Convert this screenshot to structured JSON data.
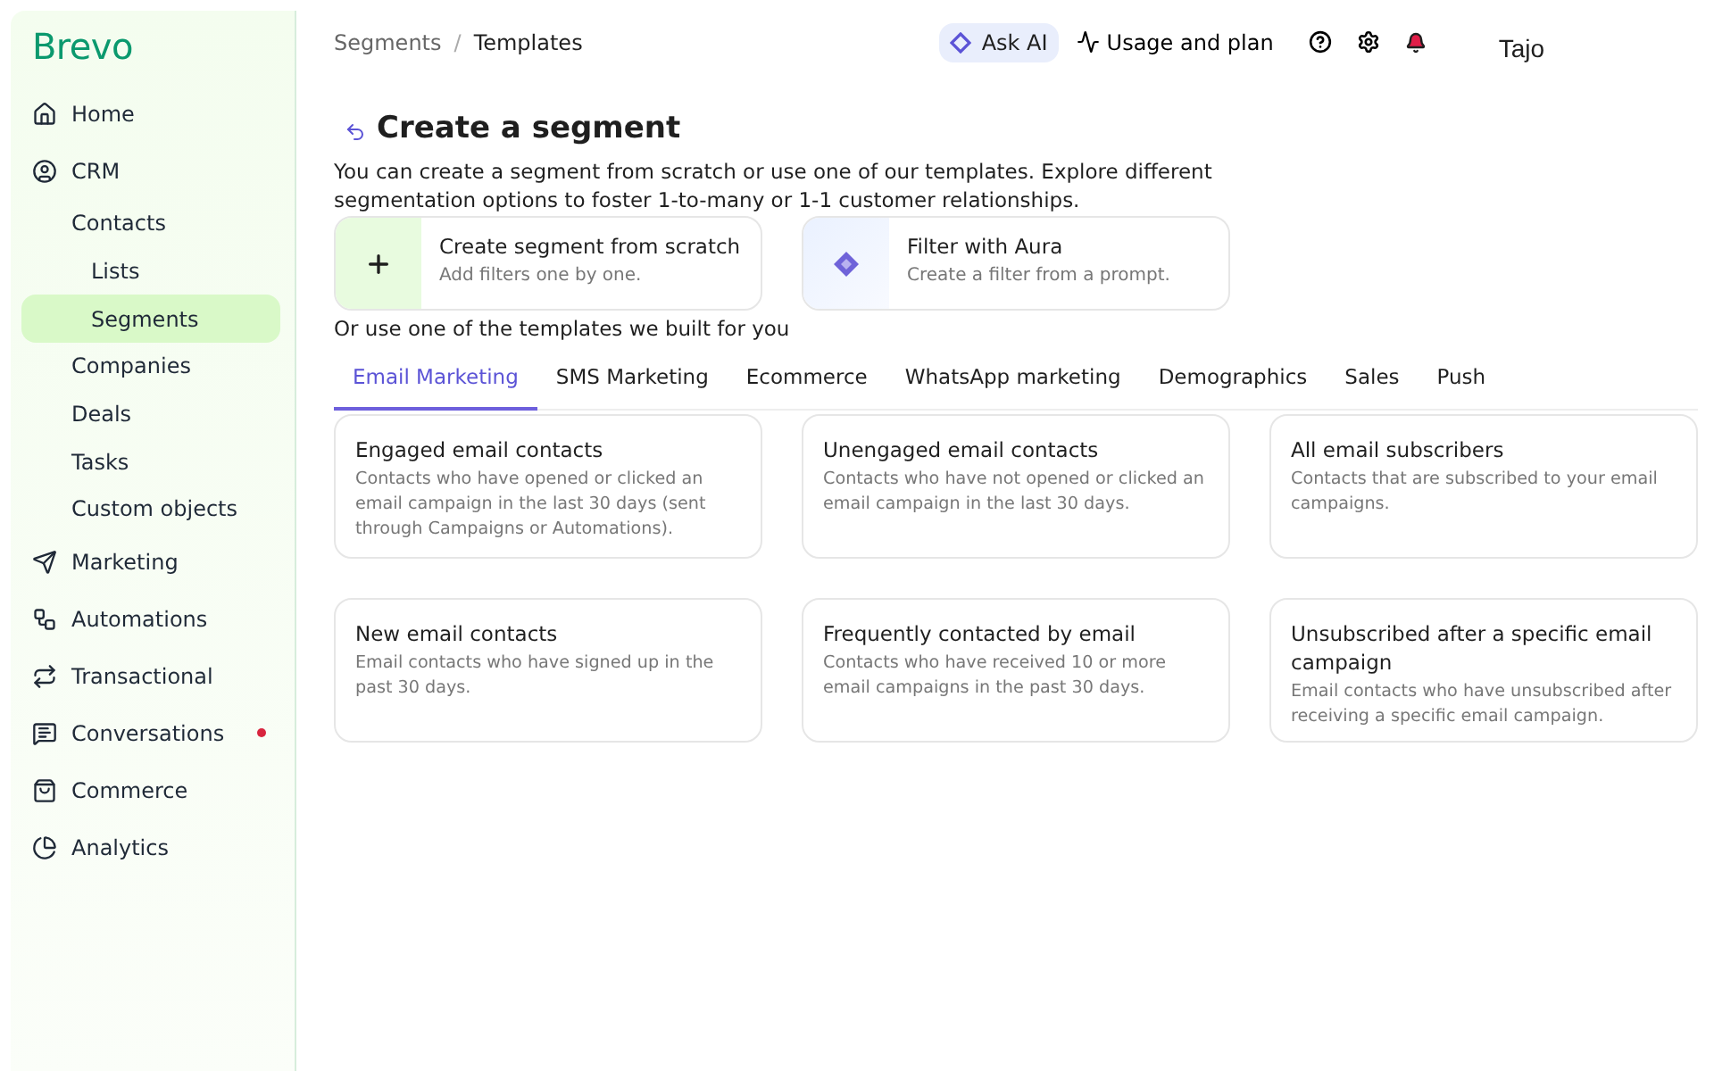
{
  "logo": "Brevo",
  "sidebar": {
    "items": [
      {
        "label": "Home",
        "selected": false,
        "dot": false
      },
      {
        "label": "CRM",
        "selected": false,
        "dot": false,
        "children": [
          {
            "label": "Contacts",
            "selected": false,
            "children": [
              {
                "label": "Lists",
                "selected": false
              },
              {
                "label": "Segments",
                "selected": true
              }
            ]
          },
          {
            "label": "Companies",
            "selected": false
          },
          {
            "label": "Deals",
            "selected": false
          },
          {
            "label": "Tasks",
            "selected": false
          },
          {
            "label": "Custom objects",
            "selected": false
          }
        ]
      },
      {
        "label": "Marketing",
        "selected": false,
        "dot": false
      },
      {
        "label": "Automations",
        "selected": false,
        "dot": false
      },
      {
        "label": "Transactional",
        "selected": false,
        "dot": false
      },
      {
        "label": "Conversations",
        "selected": false,
        "dot": true
      },
      {
        "label": "Commerce",
        "selected": false,
        "dot": false
      },
      {
        "label": "Analytics",
        "selected": false,
        "dot": false
      }
    ]
  },
  "breadcrumb": [
    "Segments",
    "Templates"
  ],
  "breadcrumb_separator": "/",
  "topbar": {
    "ask_ai": "Ask AI",
    "usage": "Usage and plan",
    "user": "Tajo"
  },
  "title": "Create a segment",
  "description": "You can create a segment from scratch or use one of our templates. Explore different segmentation options to foster 1-to-many or 1-1 customer relationships.",
  "options": [
    {
      "kind": "scratch",
      "title": "Create segment from scratch",
      "subtitle": "Add filters one by one."
    },
    {
      "kind": "aura",
      "title": "Filter with Aura",
      "subtitle": "Create a filter from a prompt."
    }
  ],
  "templates_heading": "Or use one of the templates we built for you",
  "tabs": [
    {
      "label": "Email Marketing",
      "selected": true
    },
    {
      "label": "SMS Marketing",
      "selected": false
    },
    {
      "label": "Ecommerce",
      "selected": false
    },
    {
      "label": "WhatsApp marketing",
      "selected": false
    },
    {
      "label": "Demographics",
      "selected": false
    },
    {
      "label": "Sales",
      "selected": false
    },
    {
      "label": "Push",
      "selected": false
    }
  ],
  "templates": [
    {
      "title": "Engaged email contacts",
      "description": "Contacts who have opened or clicked an email campaign in the last 30 days (sent through Campaigns or Automations)."
    },
    {
      "title": "Unengaged email contacts",
      "description": "Contacts who have not opened or clicked an email campaign in the last 30 days."
    },
    {
      "title": "All email subscribers",
      "description": "Contacts that are subscribed to your email campaigns."
    },
    {
      "title": "New email contacts",
      "description": "Email contacts who have signed up in the past 30 days."
    },
    {
      "title": "Frequently contacted by email",
      "description": "Contacts who have received 10 or more email campaigns in the past 30 days."
    },
    {
      "title": "Unsubscribed after a specific email campaign",
      "description": "Email contacts who have unsubscribed after receiving a specific email campaign."
    }
  ]
}
